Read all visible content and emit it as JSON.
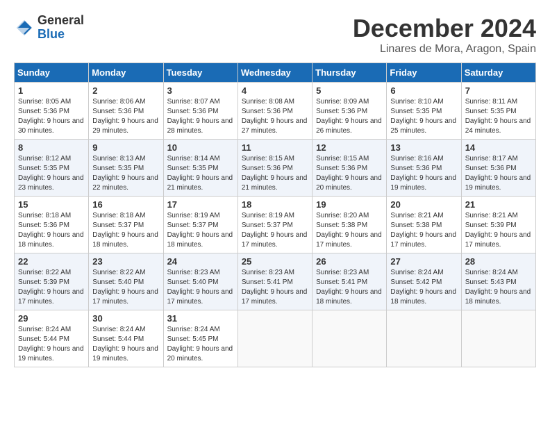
{
  "header": {
    "logo_general": "General",
    "logo_blue": "Blue",
    "month_title": "December 2024",
    "location": "Linares de Mora, Aragon, Spain"
  },
  "calendar": {
    "days_of_week": [
      "Sunday",
      "Monday",
      "Tuesday",
      "Wednesday",
      "Thursday",
      "Friday",
      "Saturday"
    ],
    "weeks": [
      [
        null,
        {
          "day": 2,
          "sunrise": "8:06 AM",
          "sunset": "5:36 PM",
          "daylight": "9 hours and 29 minutes."
        },
        {
          "day": 3,
          "sunrise": "8:07 AM",
          "sunset": "5:36 PM",
          "daylight": "9 hours and 28 minutes."
        },
        {
          "day": 4,
          "sunrise": "8:08 AM",
          "sunset": "5:36 PM",
          "daylight": "9 hours and 27 minutes."
        },
        {
          "day": 5,
          "sunrise": "8:09 AM",
          "sunset": "5:36 PM",
          "daylight": "9 hours and 26 minutes."
        },
        {
          "day": 6,
          "sunrise": "8:10 AM",
          "sunset": "5:35 PM",
          "daylight": "9 hours and 25 minutes."
        },
        {
          "day": 7,
          "sunrise": "8:11 AM",
          "sunset": "5:35 PM",
          "daylight": "9 hours and 24 minutes."
        }
      ],
      [
        {
          "day": 8,
          "sunrise": "8:12 AM",
          "sunset": "5:35 PM",
          "daylight": "9 hours and 23 minutes."
        },
        {
          "day": 9,
          "sunrise": "8:13 AM",
          "sunset": "5:35 PM",
          "daylight": "9 hours and 22 minutes."
        },
        {
          "day": 10,
          "sunrise": "8:14 AM",
          "sunset": "5:35 PM",
          "daylight": "9 hours and 21 minutes."
        },
        {
          "day": 11,
          "sunrise": "8:15 AM",
          "sunset": "5:36 PM",
          "daylight": "9 hours and 21 minutes."
        },
        {
          "day": 12,
          "sunrise": "8:15 AM",
          "sunset": "5:36 PM",
          "daylight": "9 hours and 20 minutes."
        },
        {
          "day": 13,
          "sunrise": "8:16 AM",
          "sunset": "5:36 PM",
          "daylight": "9 hours and 19 minutes."
        },
        {
          "day": 14,
          "sunrise": "8:17 AM",
          "sunset": "5:36 PM",
          "daylight": "9 hours and 19 minutes."
        }
      ],
      [
        {
          "day": 15,
          "sunrise": "8:18 AM",
          "sunset": "5:36 PM",
          "daylight": "9 hours and 18 minutes."
        },
        {
          "day": 16,
          "sunrise": "8:18 AM",
          "sunset": "5:37 PM",
          "daylight": "9 hours and 18 minutes."
        },
        {
          "day": 17,
          "sunrise": "8:19 AM",
          "sunset": "5:37 PM",
          "daylight": "9 hours and 18 minutes."
        },
        {
          "day": 18,
          "sunrise": "8:19 AM",
          "sunset": "5:37 PM",
          "daylight": "9 hours and 17 minutes."
        },
        {
          "day": 19,
          "sunrise": "8:20 AM",
          "sunset": "5:38 PM",
          "daylight": "9 hours and 17 minutes."
        },
        {
          "day": 20,
          "sunrise": "8:21 AM",
          "sunset": "5:38 PM",
          "daylight": "9 hours and 17 minutes."
        },
        {
          "day": 21,
          "sunrise": "8:21 AM",
          "sunset": "5:39 PM",
          "daylight": "9 hours and 17 minutes."
        }
      ],
      [
        {
          "day": 22,
          "sunrise": "8:22 AM",
          "sunset": "5:39 PM",
          "daylight": "9 hours and 17 minutes."
        },
        {
          "day": 23,
          "sunrise": "8:22 AM",
          "sunset": "5:40 PM",
          "daylight": "9 hours and 17 minutes."
        },
        {
          "day": 24,
          "sunrise": "8:23 AM",
          "sunset": "5:40 PM",
          "daylight": "9 hours and 17 minutes."
        },
        {
          "day": 25,
          "sunrise": "8:23 AM",
          "sunset": "5:41 PM",
          "daylight": "9 hours and 17 minutes."
        },
        {
          "day": 26,
          "sunrise": "8:23 AM",
          "sunset": "5:41 PM",
          "daylight": "9 hours and 18 minutes."
        },
        {
          "day": 27,
          "sunrise": "8:24 AM",
          "sunset": "5:42 PM",
          "daylight": "9 hours and 18 minutes."
        },
        {
          "day": 28,
          "sunrise": "8:24 AM",
          "sunset": "5:43 PM",
          "daylight": "9 hours and 18 minutes."
        }
      ],
      [
        {
          "day": 29,
          "sunrise": "8:24 AM",
          "sunset": "5:44 PM",
          "daylight": "9 hours and 19 minutes."
        },
        {
          "day": 30,
          "sunrise": "8:24 AM",
          "sunset": "5:44 PM",
          "daylight": "9 hours and 19 minutes."
        },
        {
          "day": 31,
          "sunrise": "8:24 AM",
          "sunset": "5:45 PM",
          "daylight": "9 hours and 20 minutes."
        },
        null,
        null,
        null,
        null
      ]
    ],
    "week1_day1": {
      "day": 1,
      "sunrise": "8:05 AM",
      "sunset": "5:36 PM",
      "daylight": "9 hours and 30 minutes."
    }
  }
}
